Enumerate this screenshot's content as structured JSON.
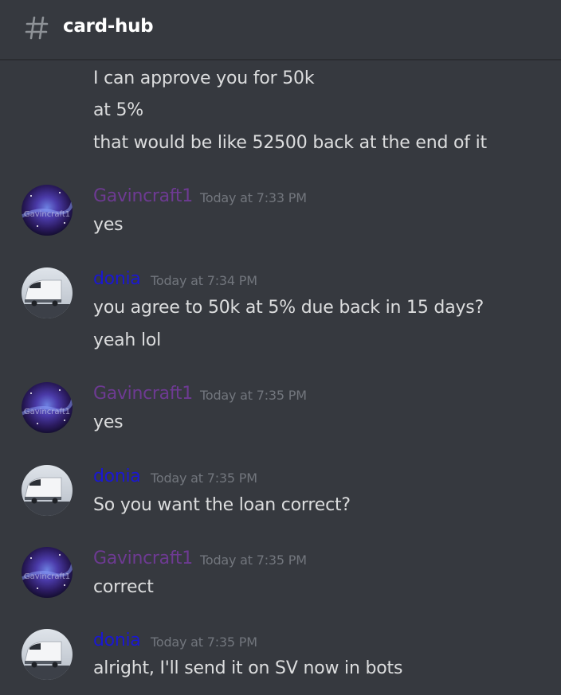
{
  "channel": {
    "icon": "hash-icon",
    "name": "card-hub"
  },
  "colors": {
    "background": "#36393f",
    "text": "#dcddde",
    "timestamp": "#72767d",
    "gavincraft1": "#6d3a92",
    "donia": "#1a17d2"
  },
  "continued_lines": [
    "I can approve you for 50k",
    "at 5%",
    "that would be like 52500 back at the end of it"
  ],
  "groups": [
    {
      "author": "Gavincraft1",
      "avatar_text": "Gavincraft1",
      "time": "Today at 7:33 PM",
      "lines": [
        "yes"
      ]
    },
    {
      "author": "donia",
      "avatar_text": "",
      "time": "Today at 7:34 PM",
      "lines": [
        "you agree to 50k at 5% due back in 15 days?",
        "yeah lol"
      ]
    },
    {
      "author": "Gavincraft1",
      "avatar_text": "Gavincraft1",
      "time": "Today at 7:35 PM",
      "lines": [
        "yes"
      ]
    },
    {
      "author": "donia",
      "avatar_text": "",
      "time": "Today at 7:35 PM",
      "lines": [
        "So you want the loan correct?"
      ]
    },
    {
      "author": "Gavincraft1",
      "avatar_text": "Gavincraft1",
      "time": "Today at 7:35 PM",
      "lines": [
        "correct"
      ]
    },
    {
      "author": "donia",
      "avatar_text": "",
      "time": "Today at 7:35 PM",
      "lines": [
        "alright, I'll send it on SV now in bots"
      ]
    }
  ]
}
